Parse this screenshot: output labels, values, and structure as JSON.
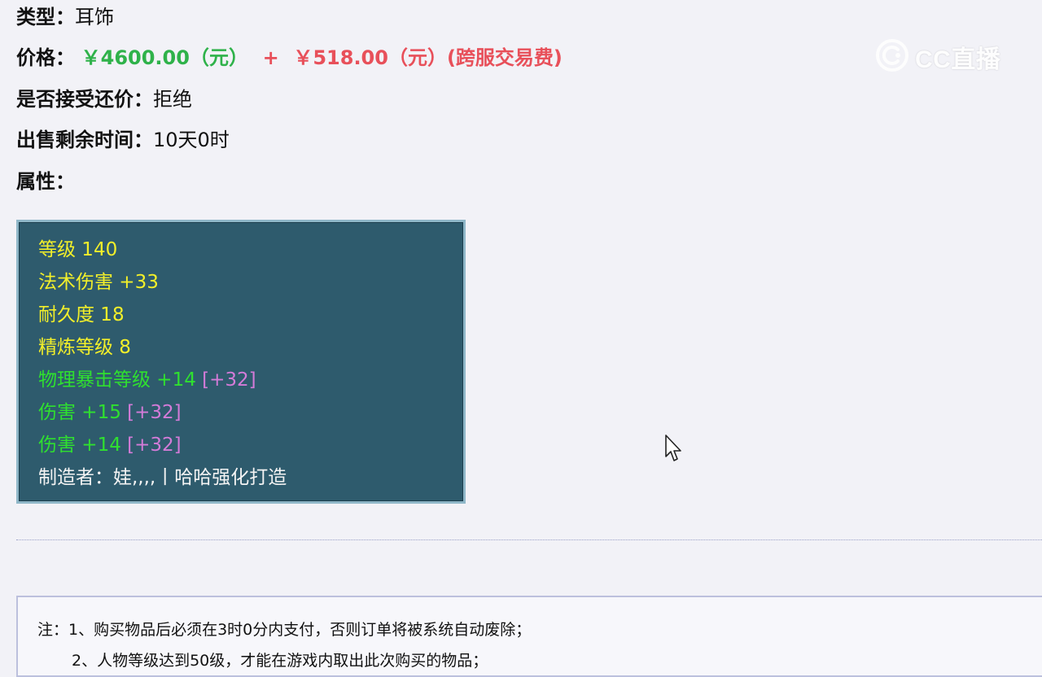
{
  "item_info": {
    "type_label": "类型：",
    "type_value": "耳饰",
    "price_label": "价格：",
    "price_main": "￥4600.00（元）",
    "price_plus": "+",
    "price_fee": "￥518.00（元）(跨服交易费)",
    "bargain_label": "是否接受还价：",
    "bargain_value": "拒绝",
    "time_label": "出售剩余时间：",
    "time_value": "10天0时",
    "attr_label": "属性："
  },
  "attributes": {
    "level": "等级 140",
    "magic_damage": "法术伤害 +33",
    "durability": "耐久度 18",
    "refine_level": "精炼等级 8",
    "crit_level_text": "物理暴击等级 +14",
    "crit_level_bonus": "[+32]",
    "damage1_text": "伤害 +15",
    "damage1_bonus": "[+32]",
    "damage2_text": "伤害 +14",
    "damage2_bonus": "[+32]",
    "maker": "制造者：娃,,,,丨哈哈强化打造"
  },
  "notes": {
    "line1": "注：1、购买物品后必须在3时0分内支付，否则订单将被系统自动废除；",
    "line2": "2、人物等级达到50级，才能在游戏内取出此次购买的物品；"
  },
  "watermark": {
    "text": "CC直播",
    "icon": "cc-logo-icon"
  },
  "colors": {
    "background": "#f2f2f7",
    "attr_box_bg": "#2e5b6d",
    "price_green": "#2fb24a",
    "price_red": "#e8505a",
    "attr_yellow": "#f2ef2a",
    "attr_green": "#2fe02f",
    "attr_pink": "#d37bd8"
  }
}
